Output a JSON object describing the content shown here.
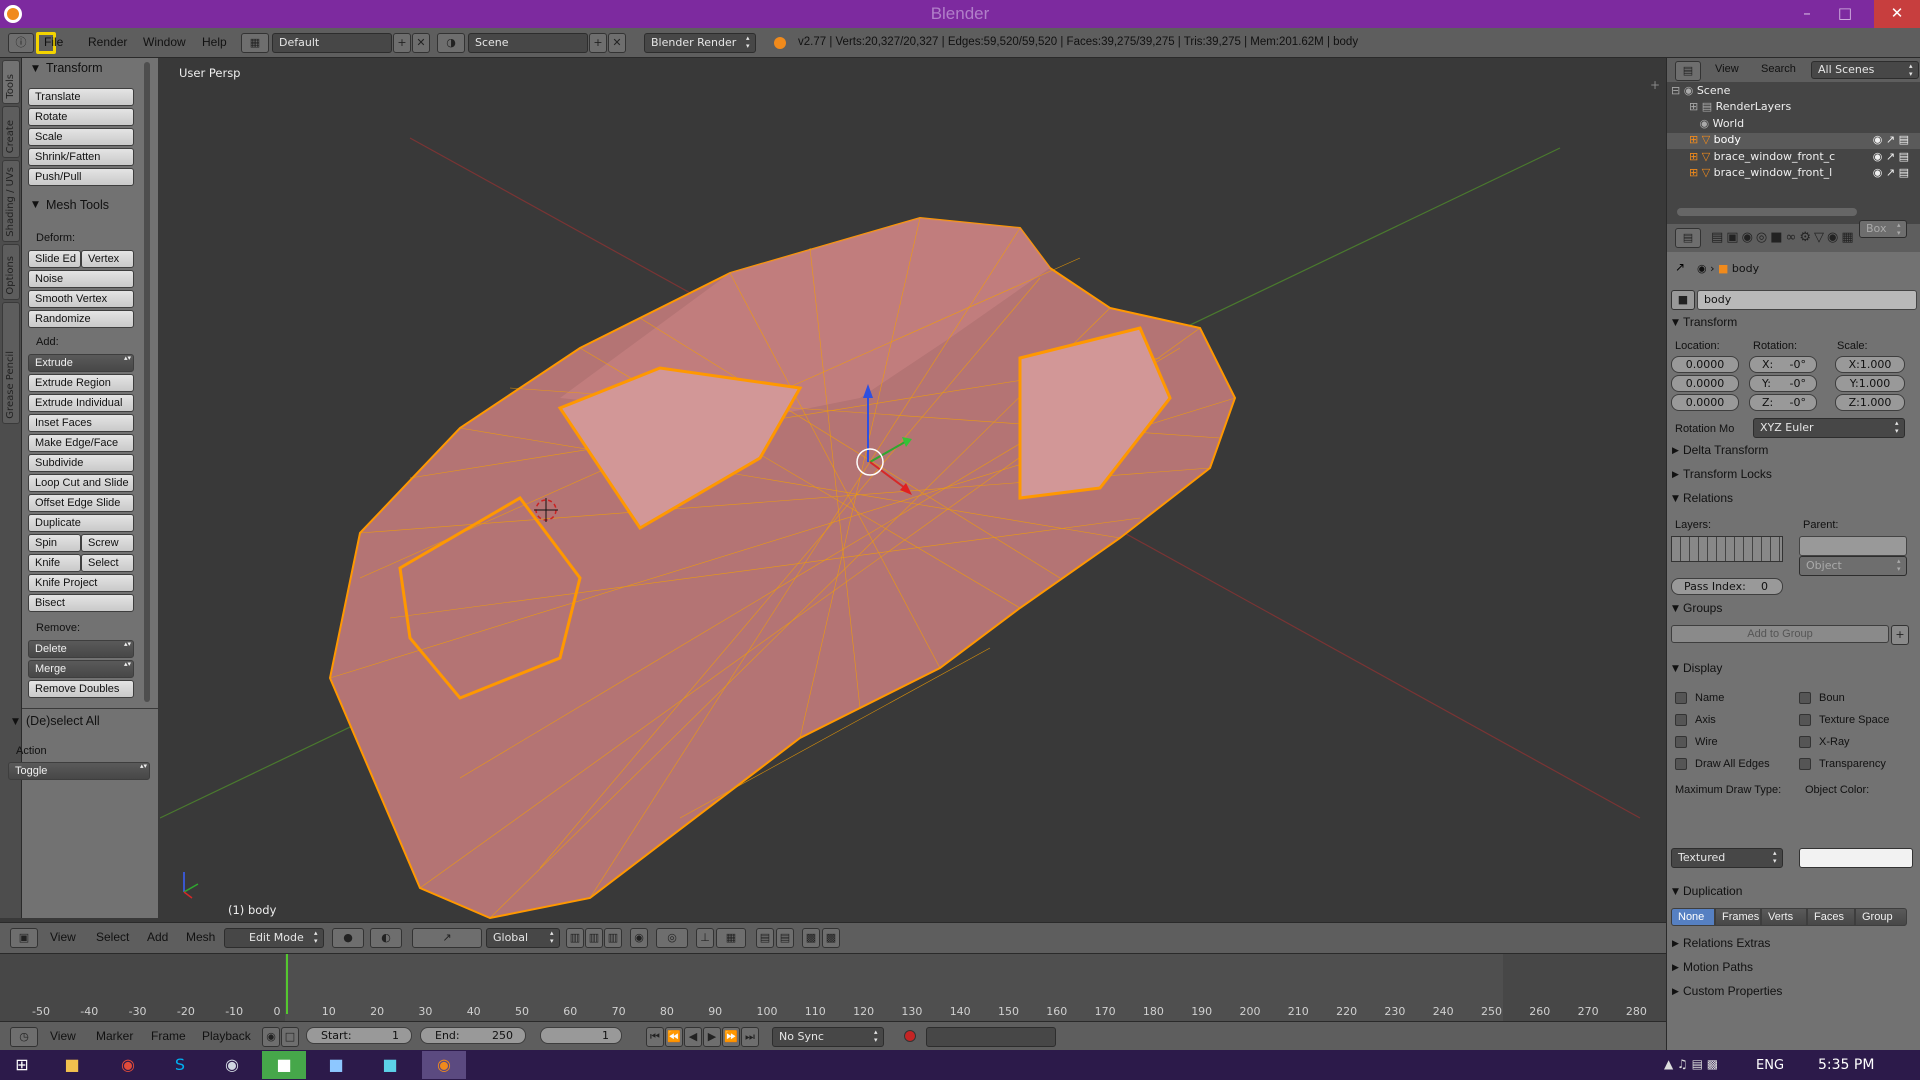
{
  "window": {
    "title": "Blender"
  },
  "info": {
    "menus": [
      "File",
      "Render",
      "Window",
      "Help"
    ],
    "layout": "Default",
    "scene": "Scene",
    "engine": "Blender Render",
    "stats": "v2.77 | Verts:20,327/20,327 | Edges:59,520/59,520 | Faces:39,275/39,275 | Tris:39,275 | Mem:201.62M | body"
  },
  "tabs": [
    "Tools",
    "Create",
    "Shading / UVs",
    "Options",
    "Grease Pencil"
  ],
  "toolshelf": {
    "transform": {
      "header": "Transform",
      "buttons": [
        "Translate",
        "Rotate",
        "Scale",
        "Shrink/Fatten",
        "Push/Pull"
      ]
    },
    "meshtools": {
      "header": "Mesh Tools",
      "deform_label": "Deform:",
      "slide": "Slide Ed",
      "vertex": "Vertex",
      "noise": "Noise",
      "smooth": "Smooth Vertex",
      "randomize": "Randomize",
      "add_label": "Add:",
      "extrude": "Extrude",
      "extrude_region": "Extrude Region",
      "extrude_individual": "Extrude Individual",
      "inset": "Inset Faces",
      "make_edge": "Make Edge/Face",
      "subdivide": "Subdivide",
      "loopcut": "Loop Cut and Slide",
      "offset_edge": "Offset Edge Slide",
      "duplicate": "Duplicate",
      "spin": "Spin",
      "screw": "Screw",
      "knife": "Knife",
      "select": "Select",
      "knife_project": "Knife Project",
      "bisect": "Bisect",
      "remove_label": "Remove:",
      "delete": "Delete",
      "merge": "Merge",
      "remove_doubles": "Remove Doubles"
    },
    "deselect": {
      "header": "(De)select All",
      "action_label": "Action",
      "action_value": "Toggle"
    }
  },
  "viewport": {
    "view_label": "User Persp",
    "object_label": "(1) body"
  },
  "view3d_header": {
    "menus": [
      "View",
      "Select",
      "Add",
      "Mesh"
    ],
    "mode": "Edit Mode",
    "orientation": "Global"
  },
  "timeline": {
    "ticks": [
      "-50",
      "-40",
      "-30",
      "-20",
      "-10",
      "0",
      "10",
      "20",
      "30",
      "40",
      "50",
      "60",
      "70",
      "80",
      "90",
      "100",
      "110",
      "120",
      "130",
      "140",
      "150",
      "160",
      "170",
      "180",
      "190",
      "200",
      "210",
      "220",
      "230",
      "240",
      "250",
      "260",
      "270",
      "280"
    ],
    "current_frame": 1,
    "menus": [
      "View",
      "Marker",
      "Frame",
      "Playback"
    ],
    "start": "Start:",
    "start_val": "1",
    "end": "End:",
    "end_val": "250",
    "frame_val": "1",
    "sync": "No Sync"
  },
  "outliner": {
    "menus": [
      "View",
      "Search"
    ],
    "filter": "All Scenes",
    "items": [
      "Scene",
      "RenderLayers",
      "World",
      "body",
      "brace_window_front_c",
      "brace_window_front_l"
    ]
  },
  "properties": {
    "breadcrumb": "body",
    "object_name": "body",
    "transform": {
      "header": "Transform",
      "location_label": "Location:",
      "rotation_label": "Rotation:",
      "scale_label": "Scale:",
      "location": [
        "0.0000",
        "0.0000",
        "0.0000"
      ],
      "rotation": [
        "X:",
        "-0°",
        "Y:",
        "-0°",
        "Z:",
        "-0°"
      ],
      "scale": [
        "X:1.000",
        "Y:1.000",
        "Z:1.000"
      ],
      "rotation_mode_label": "Rotation Mo",
      "rotation_mode": "XYZ Euler"
    },
    "delta": "Delta Transform",
    "locks": "Transform Locks",
    "relations": {
      "header": "Relations",
      "layers_label": "Layers:",
      "parent_label": "Parent:",
      "parent_type": "Object",
      "pass_index": "Pass Index:",
      "pass_index_val": "0"
    },
    "groups": {
      "header": "Groups",
      "add": "Add to Group"
    },
    "display": {
      "header": "Display",
      "name": "Name",
      "axis": "Axis",
      "wire": "Wire",
      "draw_all": "Draw All Edges",
      "bounds": "Boun",
      "bounds_type": "Box",
      "texture_space": "Texture Space",
      "xray": "X-Ray",
      "transparency": "Transparency",
      "max_draw_label": "Maximum Draw Type:",
      "max_draw": "Textured",
      "color_label": "Object Color:"
    },
    "duplication": {
      "header": "Duplication",
      "options": [
        "None",
        "Frames",
        "Verts",
        "Faces",
        "Group"
      ]
    },
    "relations_extras": "Relations Extras",
    "motion_paths": "Motion Paths",
    "custom_props": "Custom Properties"
  },
  "taskbar": {
    "lang": "ENG",
    "time": "5:35 PM"
  }
}
